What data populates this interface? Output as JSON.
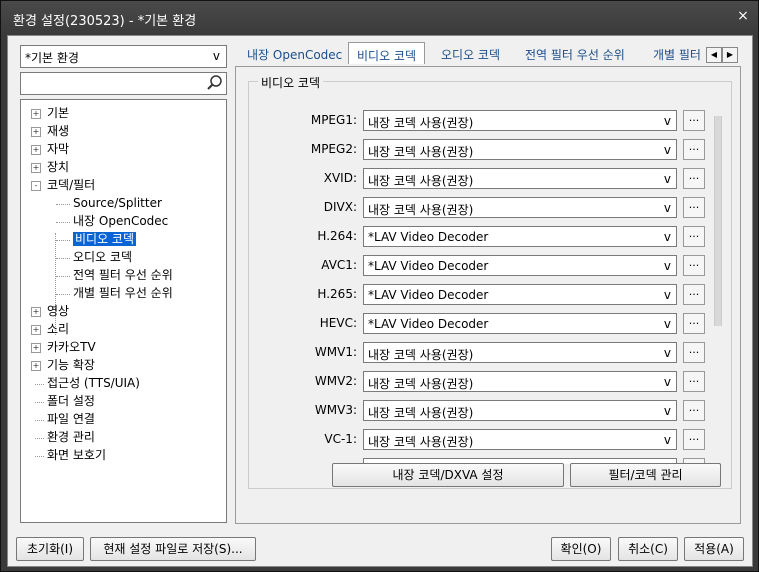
{
  "window": {
    "title": "환경 설정(230523) - *기본 환경",
    "close_label": "×"
  },
  "left": {
    "preset_value": "*기본 환경",
    "preset_arrow": "v",
    "search_placeholder": "",
    "tree": [
      {
        "label": "기본",
        "level": 0,
        "expander": "+"
      },
      {
        "label": "재생",
        "level": 0,
        "expander": "+"
      },
      {
        "label": "자막",
        "level": 0,
        "expander": "+"
      },
      {
        "label": "장치",
        "level": 0,
        "expander": "+"
      },
      {
        "label": "코덱/필터",
        "level": 0,
        "expander": "-"
      },
      {
        "label": "Source/Splitter",
        "level": 1
      },
      {
        "label": "내장 OpenCodec",
        "level": 1
      },
      {
        "label": "비디오 코덱",
        "level": 1,
        "selected": true
      },
      {
        "label": "오디오 코덱",
        "level": 1
      },
      {
        "label": "전역 필터 우선 순위",
        "level": 1
      },
      {
        "label": "개별 필터 우선 순위",
        "level": 1
      },
      {
        "label": "영상",
        "level": 0,
        "expander": "+"
      },
      {
        "label": "소리",
        "level": 0,
        "expander": "+"
      },
      {
        "label": "카카오TV",
        "level": 0,
        "expander": "+"
      },
      {
        "label": "기능 확장",
        "level": 0,
        "expander": "+"
      },
      {
        "label": "접근성 (TTS/UIA)",
        "level": 0
      },
      {
        "label": "폴더 설정",
        "level": 0
      },
      {
        "label": "파일 연결",
        "level": 0
      },
      {
        "label": "환경 관리",
        "level": 0
      },
      {
        "label": "화면 보호기",
        "level": 0
      }
    ]
  },
  "tabs": [
    {
      "label": "내장 OpenCodec",
      "active": false
    },
    {
      "label": "비디오 코덱",
      "active": true
    },
    {
      "label": "오디오 코덱",
      "active": false
    },
    {
      "label": "전역 필터 우선 순위",
      "active": false
    },
    {
      "label": "개별 필터",
      "active": false
    }
  ],
  "tab_scroll": {
    "left": "◀",
    "right": "▶"
  },
  "group_title": "비디오 코덱",
  "codecs": [
    {
      "name": "MPEG1:",
      "value": "내장 코덱 사용(권장)"
    },
    {
      "name": "MPEG2:",
      "value": "내장 코덱 사용(권장)"
    },
    {
      "name": "XVID:",
      "value": "내장 코덱 사용(권장)"
    },
    {
      "name": "DIVX:",
      "value": "내장 코덱 사용(권장)"
    },
    {
      "name": "H.264:",
      "value": "*LAV Video Decoder"
    },
    {
      "name": "AVC1:",
      "value": "*LAV Video Decoder"
    },
    {
      "name": "H.265:",
      "value": "*LAV Video Decoder"
    },
    {
      "name": "HEVC:",
      "value": "*LAV Video Decoder"
    },
    {
      "name": "WMV1:",
      "value": "내장 코덱 사용(권장)"
    },
    {
      "name": "WMV2:",
      "value": "내장 코덱 사용(권장)"
    },
    {
      "name": "WMV3:",
      "value": "내장 코덱 사용(권장)"
    },
    {
      "name": "VC-1:",
      "value": "내장 코덱 사용(권장)"
    }
  ],
  "codec_arrow": "v",
  "dots_label": "...",
  "panel_buttons": {
    "dxva": "내장 코덱/DXVA 설정",
    "filter_mgmt": "필터/코덱 관리"
  },
  "footer": {
    "reset": "초기화(I)",
    "save_current": "현재 설정 파일로 저장(S)...",
    "ok": "확인(O)",
    "cancel": "취소(C)",
    "apply": "적용(A)"
  }
}
